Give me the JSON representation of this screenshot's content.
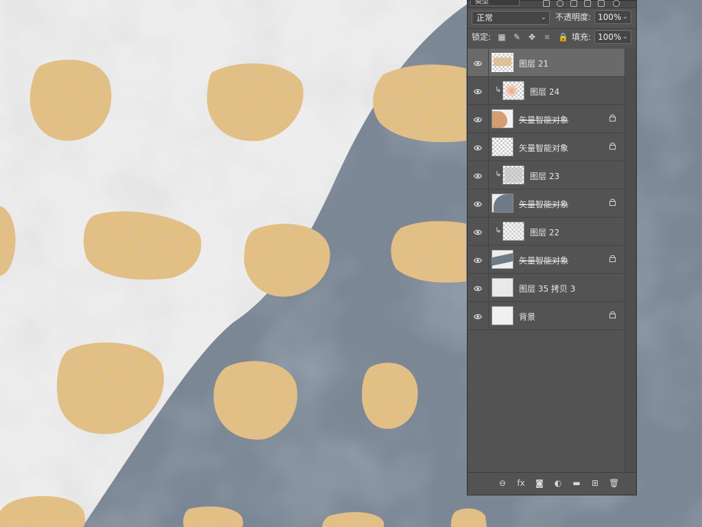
{
  "panel": {
    "filter_label": "类型",
    "blend_mode": "正常",
    "opacity_label": "不透明度:",
    "opacity_value": "100%",
    "lock_label": "锁定:",
    "fill_label": "填充:",
    "fill_value": "100%"
  },
  "layers": [
    {
      "name": "图层 21",
      "selected": true,
      "clipped": false,
      "locked": false,
      "thumb": "checker-gold",
      "strike": false
    },
    {
      "name": "图层 24",
      "selected": false,
      "clipped": true,
      "locked": false,
      "thumb": "checker-pink",
      "strike": false
    },
    {
      "name": "矢量智能对象",
      "selected": false,
      "clipped": false,
      "locked": true,
      "thumb": "tan-shape",
      "strike": true
    },
    {
      "name": "矢量智能对象",
      "selected": false,
      "clipped": false,
      "locked": true,
      "thumb": "checker-white",
      "strike": false
    },
    {
      "name": "图层 23",
      "selected": false,
      "clipped": true,
      "locked": false,
      "thumb": "checker-grey",
      "strike": false
    },
    {
      "name": "矢量智能对象",
      "selected": false,
      "clipped": false,
      "locked": true,
      "thumb": "slate-shape",
      "strike": true
    },
    {
      "name": "图层 22",
      "selected": false,
      "clipped": true,
      "locked": false,
      "thumb": "checker",
      "strike": false
    },
    {
      "name": "矢量智能对象",
      "selected": false,
      "clipped": false,
      "locked": true,
      "thumb": "slate-wave",
      "strike": true
    },
    {
      "name": "图层 35 拷贝 3",
      "selected": false,
      "clipped": false,
      "locked": false,
      "thumb": "marble",
      "strike": false
    },
    {
      "name": "背景",
      "selected": false,
      "clipped": false,
      "locked": true,
      "thumb": "white",
      "strike": false
    }
  ],
  "bottom_icons": [
    "link-icon",
    "fx-icon",
    "mask-icon",
    "adjustment-icon",
    "folder-icon",
    "new-layer-icon",
    "trash-icon"
  ],
  "bottom_glyphs": [
    "⊖",
    "fx",
    "◙",
    "◐",
    "▬",
    "⊞",
    "🗑"
  ],
  "colors": {
    "gold": "#e3bf7e",
    "gold_dark": "#b8864a",
    "canvas_light": "#ececec",
    "canvas_slate": "#7d8896",
    "panel_bg": "#535353"
  }
}
